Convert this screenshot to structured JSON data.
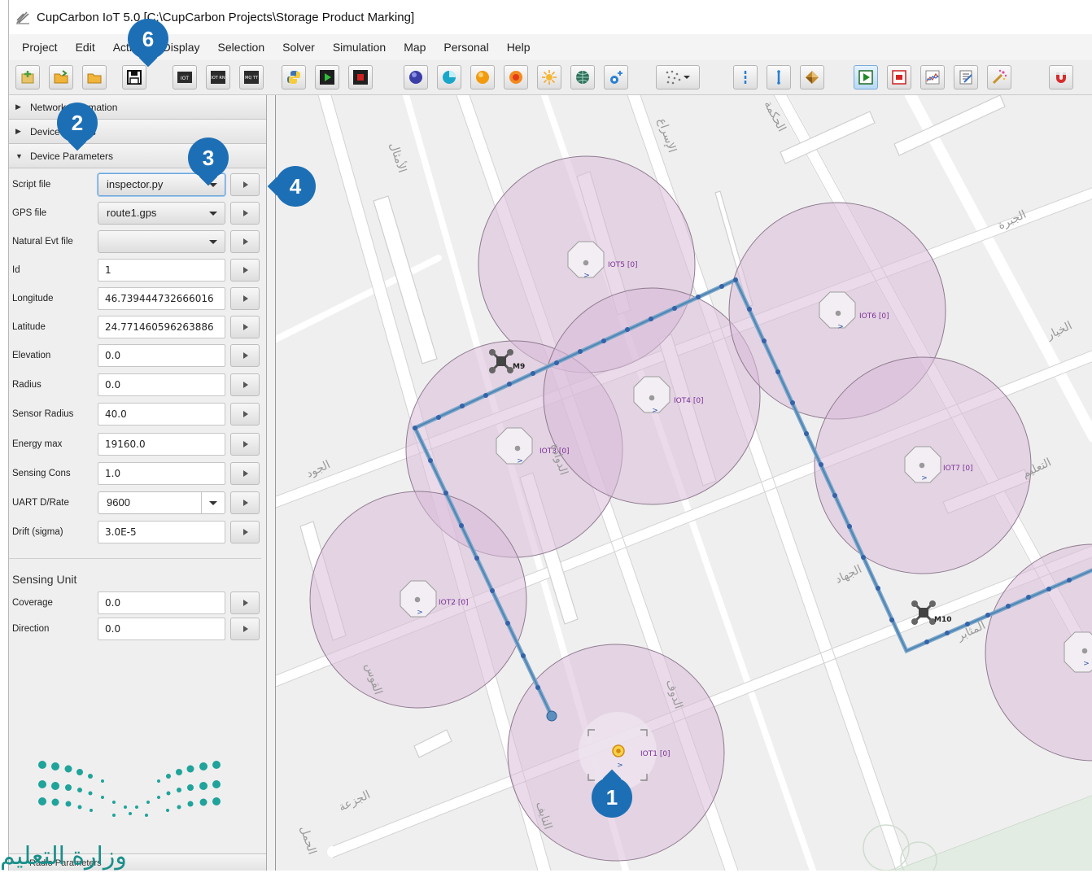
{
  "window": {
    "title": "CupCarbon IoT 5.0 [C:\\CupCarbon Projects\\Storage Product Marking]"
  },
  "menu": [
    "Project",
    "Edit",
    "Action",
    "Display",
    "Selection",
    "Solver",
    "Simulation",
    "Map",
    "Personal",
    "Help"
  ],
  "toolbar": {
    "icon_labels": {
      "iot": "IOT",
      "iot_rn": "IOT RN",
      "mq_tt": "MQ TT"
    }
  },
  "panel": {
    "network_information": "Network Information",
    "device_objects": "Device Objects",
    "device_parameters": "Device Parameters",
    "params": [
      {
        "label": "Script file",
        "value": "inspector.py",
        "kind": "combo"
      },
      {
        "label": "GPS file",
        "value": "route1.gps",
        "kind": "combo"
      },
      {
        "label": "Natural Evt  file",
        "value": "",
        "kind": "combo"
      },
      {
        "label": "Id",
        "value": "1",
        "kind": "field"
      },
      {
        "label": "Longitude",
        "value": "46.739444732666016",
        "kind": "field"
      },
      {
        "label": "Latitude",
        "value": "24.771460596263886",
        "kind": "field"
      },
      {
        "label": "Elevation",
        "value": "0.0",
        "kind": "field"
      },
      {
        "label": "Radius",
        "value": "0.0",
        "kind": "field"
      },
      {
        "label": "Sensor Radius",
        "value": "40.0",
        "kind": "field"
      },
      {
        "label": "Energy max",
        "value": "19160.0",
        "kind": "field"
      },
      {
        "label": "Sensing Cons",
        "value": "1.0",
        "kind": "field"
      },
      {
        "label": "UART D/Rate",
        "value": "9600",
        "kind": "split-combo"
      },
      {
        "label": "Drift (sigma)",
        "value": "3.0E-5",
        "kind": "field"
      }
    ],
    "sensing_unit": {
      "title": "Sensing Unit",
      "params": [
        {
          "label": "Coverage",
          "value": "0.0"
        },
        {
          "label": "Direction",
          "value": "0.0"
        }
      ]
    },
    "radio_parameters": "Radio Parameters"
  },
  "map": {
    "nodes": [
      {
        "id": "iot1",
        "label": "IOT1 [0]",
        "selected": true
      },
      {
        "id": "iot2",
        "label": "IOT2 [0]"
      },
      {
        "id": "iot3",
        "label": "IOT3 [0]"
      },
      {
        "id": "iot4",
        "label": "IOT4 [0]"
      },
      {
        "id": "iot5",
        "label": "IOT5 [0]"
      },
      {
        "id": "iot6",
        "label": "IOT6 [0]"
      },
      {
        "id": "iot7",
        "label": "IOT7 [0]"
      },
      {
        "id": "iot8",
        "label": ""
      }
    ],
    "mobiles": [
      {
        "id": "m9",
        "label": "M9"
      },
      {
        "id": "m10",
        "label": "M10"
      }
    ],
    "street_labels": [
      "الإسراع",
      "الأمثال",
      "الحكمة",
      "الجبرة",
      "الخيار",
      "الجود",
      "الدوادة",
      "الجهاد",
      "الدوف",
      "القوس",
      "الجزعة",
      "المثابر",
      "التعليم",
      "الحمل",
      "النايف"
    ]
  },
  "badges": [
    "1",
    "2",
    "3",
    "4",
    "6"
  ],
  "logo": {
    "text": "وزارة التعليم"
  },
  "colors": {
    "accent": "#1d6fb5",
    "coverage": "#d8b9d6",
    "route": "#4f86b4",
    "node_label": "#7b2f95"
  }
}
